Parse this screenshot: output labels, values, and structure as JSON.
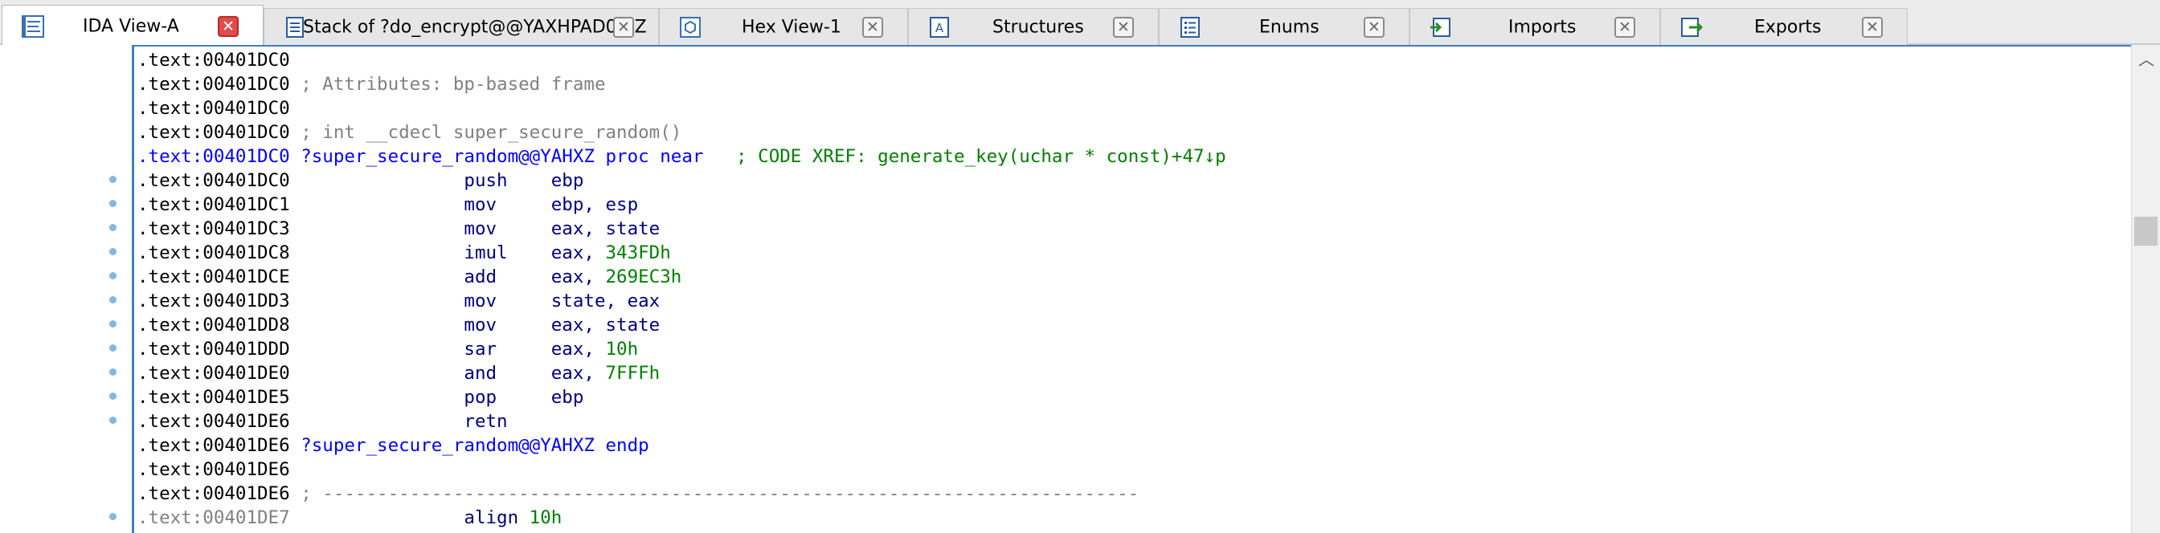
{
  "tabs": [
    {
      "label": "IDA View-A",
      "active": true,
      "icon": "disassembly-view-icon"
    },
    {
      "label": "Stack of ?do_encrypt@@YAXHPAD0@Z",
      "active": false,
      "icon": "stack-frame-icon"
    },
    {
      "label": "Hex View-1",
      "active": false,
      "icon": "hex-view-icon"
    },
    {
      "label": "Structures",
      "active": false,
      "icon": "structures-icon"
    },
    {
      "label": "Enums",
      "active": false,
      "icon": "enums-icon"
    },
    {
      "label": "Imports",
      "active": false,
      "icon": "imports-icon"
    },
    {
      "label": "Exports",
      "active": false,
      "icon": "exports-icon"
    }
  ],
  "close_glyph": "✕",
  "scroll_up_glyph": "︿",
  "listing": [
    {
      "addr": ".text:00401DC0",
      "parts": []
    },
    {
      "addr": ".text:00401DC0",
      "parts": [
        {
          "t": " ; Attributes: bp-based frame",
          "c": "cmt"
        }
      ]
    },
    {
      "addr": ".text:00401DC0",
      "parts": []
    },
    {
      "addr": ".text:00401DC0",
      "parts": [
        {
          "t": " ; int __cdecl super_secure_random()",
          "c": "cmt"
        }
      ]
    },
    {
      "addr": ".text:00401DC0",
      "current": true,
      "parts": [
        {
          "t": " ?super_secure_random@@YAHXZ proc near",
          "c": "name"
        },
        {
          "t": "   ; CODE XREF: generate_key(uchar * const)+47↓p",
          "c": "xref"
        }
      ]
    },
    {
      "addr": ".text:00401DC0",
      "dot": true,
      "parts": [
        {
          "t": "                push    ",
          "c": "mnem"
        },
        {
          "t": "ebp",
          "c": "opnd"
        }
      ]
    },
    {
      "addr": ".text:00401DC1",
      "dot": true,
      "parts": [
        {
          "t": "                mov     ",
          "c": "mnem"
        },
        {
          "t": "ebp, esp",
          "c": "opnd"
        }
      ]
    },
    {
      "addr": ".text:00401DC3",
      "dot": true,
      "parts": [
        {
          "t": "                mov     ",
          "c": "mnem"
        },
        {
          "t": "eax, state",
          "c": "opnd"
        }
      ]
    },
    {
      "addr": ".text:00401DC8",
      "dot": true,
      "parts": [
        {
          "t": "                imul    ",
          "c": "mnem"
        },
        {
          "t": "eax, ",
          "c": "opnd"
        },
        {
          "t": "343FDh",
          "c": "num"
        }
      ]
    },
    {
      "addr": ".text:00401DCE",
      "dot": true,
      "parts": [
        {
          "t": "                add     ",
          "c": "mnem"
        },
        {
          "t": "eax, ",
          "c": "opnd"
        },
        {
          "t": "269EC3h",
          "c": "num"
        }
      ]
    },
    {
      "addr": ".text:00401DD3",
      "dot": true,
      "parts": [
        {
          "t": "                mov     ",
          "c": "mnem"
        },
        {
          "t": "state, eax",
          "c": "opnd"
        }
      ]
    },
    {
      "addr": ".text:00401DD8",
      "dot": true,
      "parts": [
        {
          "t": "                mov     ",
          "c": "mnem"
        },
        {
          "t": "eax, state",
          "c": "opnd"
        }
      ]
    },
    {
      "addr": ".text:00401DDD",
      "dot": true,
      "parts": [
        {
          "t": "                sar     ",
          "c": "mnem"
        },
        {
          "t": "eax, ",
          "c": "opnd"
        },
        {
          "t": "10h",
          "c": "num"
        }
      ]
    },
    {
      "addr": ".text:00401DE0",
      "dot": true,
      "parts": [
        {
          "t": "                and     ",
          "c": "mnem"
        },
        {
          "t": "eax, ",
          "c": "opnd"
        },
        {
          "t": "7FFFh",
          "c": "num"
        }
      ]
    },
    {
      "addr": ".text:00401DE5",
      "dot": true,
      "parts": [
        {
          "t": "                pop     ",
          "c": "mnem"
        },
        {
          "t": "ebp",
          "c": "opnd"
        }
      ]
    },
    {
      "addr": ".text:00401DE6",
      "dot": true,
      "parts": [
        {
          "t": "                retn",
          "c": "mnem"
        }
      ]
    },
    {
      "addr": ".text:00401DE6",
      "parts": [
        {
          "t": " ?super_secure_random@@YAHXZ endp",
          "c": "name"
        }
      ]
    },
    {
      "addr": ".text:00401DE6",
      "parts": []
    },
    {
      "addr": ".text:00401DE6",
      "parts": [
        {
          "t": " ; ---------------------------------------------------------------------------",
          "c": "cmt"
        }
      ]
    },
    {
      "addr": ".text:00401DE7",
      "dim": true,
      "dot": true,
      "parts": [
        {
          "t": "                align ",
          "c": "mnem"
        },
        {
          "t": "10h",
          "c": "num"
        }
      ]
    }
  ]
}
